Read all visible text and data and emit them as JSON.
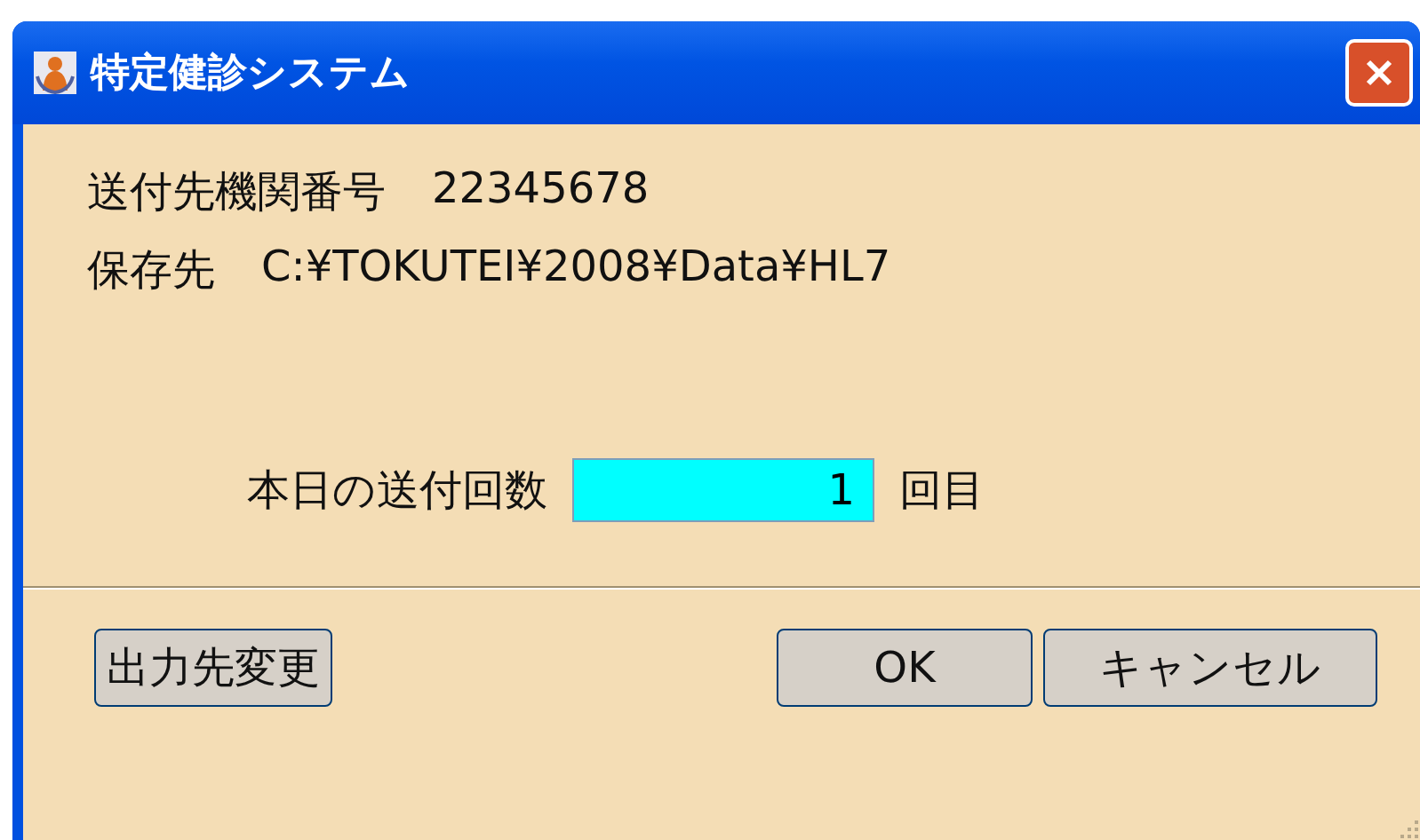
{
  "window": {
    "title": "特定健診システム"
  },
  "info": [
    {
      "label": "送付先機関番号",
      "value": "22345678"
    },
    {
      "label": "保存先",
      "value": "C:¥TOKUTEI¥2008¥Data¥HL7"
    }
  ],
  "count": {
    "label": "本日の送付回数",
    "value": "1",
    "unit": "回目"
  },
  "buttons": {
    "left": "出力先変更",
    "ok": "OK",
    "cancel": "キャンセル"
  }
}
